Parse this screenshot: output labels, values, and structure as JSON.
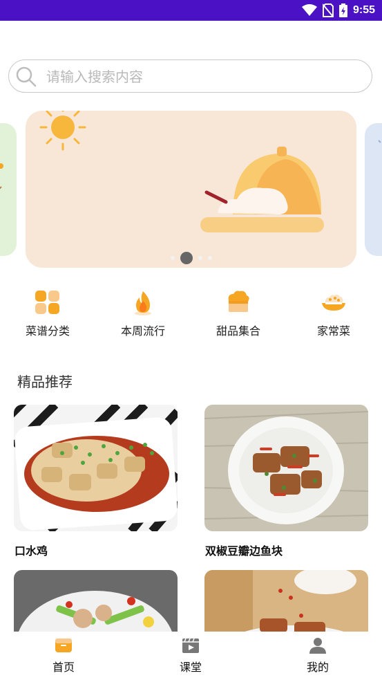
{
  "status_bar": {
    "time": "9:55",
    "icons": [
      "wifi-icon",
      "no-sim-icon",
      "battery-charging-icon"
    ]
  },
  "search": {
    "placeholder": "请输入搜索内容"
  },
  "banner": {
    "pages": 4,
    "active_page": 1
  },
  "categories": [
    {
      "label": "菜谱分类",
      "icon": "grid-squares-icon"
    },
    {
      "label": "本周流行",
      "icon": "flame-icon"
    },
    {
      "label": "甜品集合",
      "icon": "cupcake-icon"
    },
    {
      "label": "家常菜",
      "icon": "food-bowl-icon"
    }
  ],
  "section": {
    "title": "精品推荐"
  },
  "recipes": [
    {
      "title": "口水鸡"
    },
    {
      "title": "双椒豆瓣边鱼块"
    },
    {
      "title": ""
    },
    {
      "title": ""
    }
  ],
  "bottom_nav": [
    {
      "label": "首页",
      "icon": "home-box-icon",
      "active": true
    },
    {
      "label": "课堂",
      "icon": "video-play-icon",
      "active": false
    },
    {
      "label": "我的",
      "icon": "person-icon",
      "active": false
    }
  ],
  "colors": {
    "status_bar": "#4a12c4",
    "accent": "#f5a623",
    "banner_bg": "#f8e6d6",
    "nav_inactive": "#777777"
  }
}
